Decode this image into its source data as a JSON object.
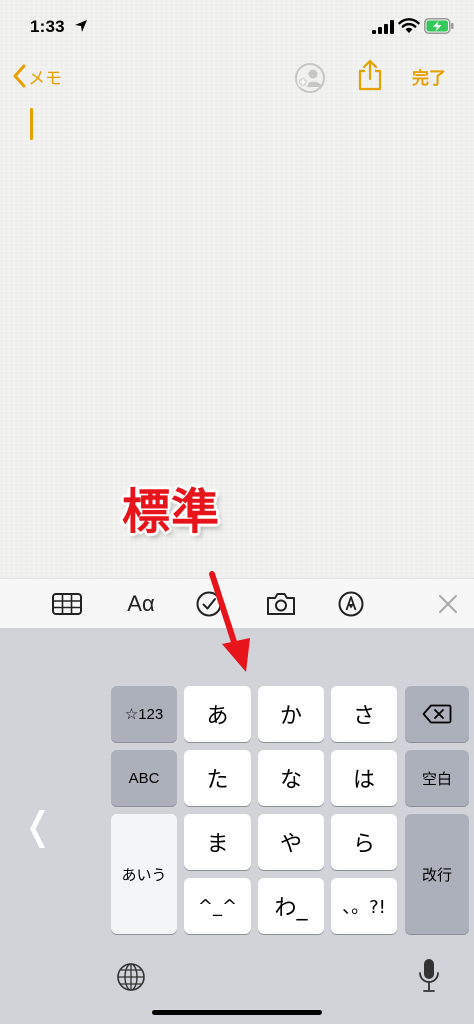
{
  "status_bar": {
    "time": "1:33"
  },
  "nav": {
    "back_label": "メモ",
    "done_label": "完了"
  },
  "annotation": {
    "text": "標準"
  },
  "toolbar": {
    "format_label": "Aα"
  },
  "keyboard": {
    "row1": {
      "left": "☆123",
      "k1": "あ",
      "k2": "か",
      "k3": "さ"
    },
    "row2": {
      "left": "ABC",
      "k1": "た",
      "k2": "な",
      "k3": "は",
      "right": "空白"
    },
    "row3": {
      "k1": "ま",
      "k2": "や",
      "k3": "ら"
    },
    "row4": {
      "k1": "^_^",
      "k2": "わ_",
      "k3": "、。?!"
    },
    "left_tall": "あいう",
    "right_tall": "改行",
    "side_chevron": "❬"
  },
  "colors": {
    "accent": "#e5a100",
    "annotation": "#e8141c",
    "battery": "#34c759"
  }
}
